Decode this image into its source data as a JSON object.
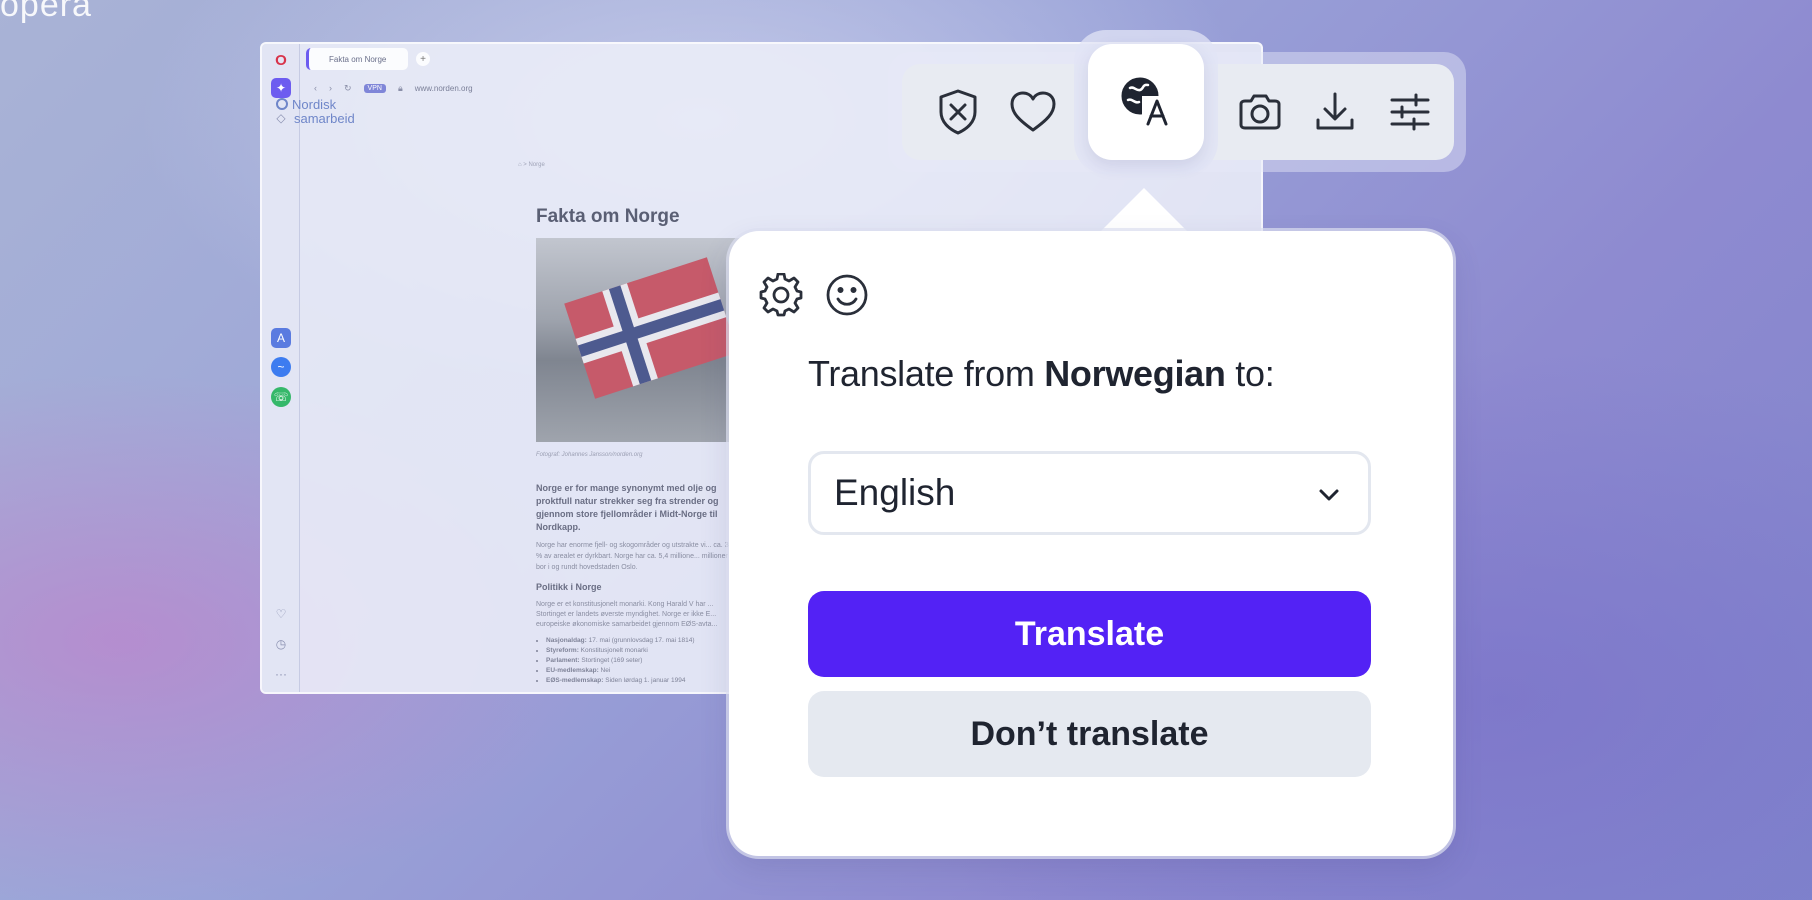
{
  "brand_corner": "opera",
  "browser": {
    "tab_title": "Fakta om Norge",
    "tab_add": "+",
    "vpn_badge": "VPN",
    "url": "www.norden.org",
    "site_logo_line1": "Nordisk",
    "site_logo_line2": "samarbeid",
    "breadcrumb": "⌂ > Norge",
    "article_title": "Fakta om Norge",
    "photo_caption": "Fotograf: Johannes Jansson/norden.org",
    "para1": "Norge er for mange synonymt med olje og proktfull natur strekker seg fra strender og gjennom store fjellområder i Midt-Norge til Nordkapp.",
    "para2": "Norge har enorme fjell- og skogområder og utstrakte vi... ca. 3 % av arealet er dyrkbart. Norge har ca. 5,4 millione... millioner bor i og rundt hovedstaden Oslo.",
    "politics_heading": "Politikk i Norge",
    "para3": "Norge er et konstitusjonelt monarki. Kong Harald V har ... Stortinget er landets øverste myndighet. Norge er ikke E... europeiske økonomiske samarbeidet gjennom EØS-avta...",
    "facts": [
      {
        "label": "Nasjonaldag:",
        "value": " 17. mai (grunnlovsdag 17. mai 1814)"
      },
      {
        "label": "Styreform:",
        "value": " Konstitusjonelt monarki"
      },
      {
        "label": "Parlament:",
        "value": " Stortinget (169 seter)"
      },
      {
        "label": "EU-medlemskap:",
        "value": " Nei"
      },
      {
        "label": "EØS-medlemskap:",
        "value": " Siden lørdag 1. januar 1994"
      }
    ]
  },
  "toolbar": {
    "icons": [
      "shield-x-icon",
      "heart-icon",
      "translate-icon",
      "camera-icon",
      "download-icon",
      "sliders-icon"
    ],
    "active": "translate-icon"
  },
  "popup": {
    "heading_prefix": "Translate from ",
    "source_language": "Norwegian",
    "heading_suffix": " to:",
    "target_language": "English",
    "translate_button": "Translate",
    "dont_translate_button": "Don’t translate"
  },
  "colors": {
    "primary": "#5322f5",
    "secondary_button": "#e5e9f0",
    "text": "#1f2430"
  }
}
